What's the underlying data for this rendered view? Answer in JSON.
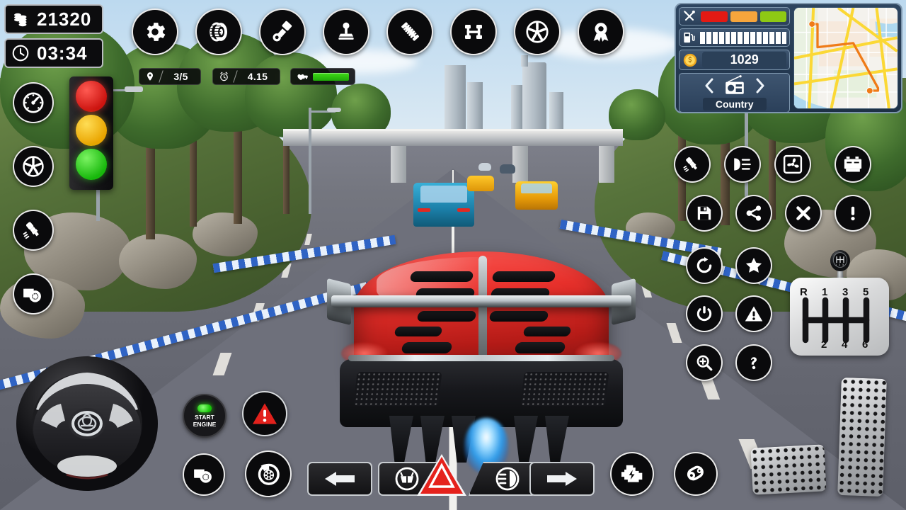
{
  "hud": {
    "coins": {
      "icon": "coins-icon",
      "value": "21320"
    },
    "timer": {
      "icon": "clock-icon",
      "value": "03:34"
    },
    "checkpoints": {
      "icon": "location-pin-icon",
      "value": "3/5"
    },
    "lap_time": {
      "icon": "alarm-clock-icon",
      "value": "4.15"
    },
    "health": {
      "icon": "car-health-icon",
      "value": "100"
    }
  },
  "top_toolbar": {
    "items": [
      {
        "name": "settings-button",
        "icon": "gear-icon",
        "label": "Settings"
      },
      {
        "name": "tire-button",
        "icon": "tire-icon",
        "label": "Tires"
      },
      {
        "name": "piston-button",
        "icon": "piston-icon",
        "label": "Piston"
      },
      {
        "name": "gearstick-button",
        "icon": "joystick-icon",
        "label": "Gear Stick"
      },
      {
        "name": "suspension-button",
        "icon": "suspension-icon",
        "label": "Suspension"
      },
      {
        "name": "chassis-button",
        "icon": "chassis-icon",
        "label": "Chassis"
      },
      {
        "name": "rim-button",
        "icon": "wheel-rim-icon",
        "label": "Rims"
      },
      {
        "name": "award-button",
        "icon": "award-medal-icon",
        "label": "Awards"
      }
    ]
  },
  "left_toolbar": {
    "items": [
      {
        "name": "speedometer-button",
        "icon": "speedometer-icon",
        "label": "Speedometer"
      },
      {
        "name": "rim-button-left",
        "icon": "wheel-rim-icon",
        "label": "Rims"
      },
      {
        "name": "spark-plug-button",
        "icon": "spark-plug-icon",
        "label": "Spark Plug"
      },
      {
        "name": "turbo-button",
        "icon": "turbocharger-icon",
        "label": "Turbo"
      }
    ]
  },
  "right_toolbar": {
    "row1": [
      {
        "name": "spark-plug-button-right",
        "icon": "spark-plug-icon",
        "label": "Spark Plug"
      },
      {
        "name": "headlight-button-right",
        "icon": "headlight-icon",
        "label": "Headlights"
      },
      {
        "name": "fan-button",
        "icon": "cooling-fan-icon",
        "label": "Cooling Fan"
      },
      {
        "name": "battery-button",
        "icon": "battery-icon",
        "label": "Battery"
      }
    ],
    "row2": [
      {
        "name": "save-button",
        "icon": "floppy-save-icon",
        "label": "Save"
      },
      {
        "name": "share-button",
        "icon": "share-icon",
        "label": "Share"
      },
      {
        "name": "close-button",
        "icon": "close-x-icon",
        "label": "Close"
      },
      {
        "name": "info-button",
        "icon": "exclamation-icon",
        "label": "Info"
      }
    ],
    "row3": [
      {
        "name": "restart-button",
        "icon": "refresh-icon",
        "label": "Restart"
      },
      {
        "name": "favorite-button",
        "icon": "star-icon",
        "label": "Favorite"
      }
    ],
    "row4": [
      {
        "name": "power-button",
        "icon": "power-icon",
        "label": "Power"
      },
      {
        "name": "warning-button",
        "icon": "warning-triangle-icon",
        "label": "Warning"
      }
    ],
    "row5": [
      {
        "name": "zoom-button",
        "icon": "magnifier-plus-icon",
        "label": "Zoom"
      },
      {
        "name": "help-button",
        "icon": "question-mark-icon",
        "label": "Help"
      }
    ]
  },
  "panel": {
    "damage": {
      "icon": "tools-icon",
      "bars": [
        {
          "name": "damage-bar-red",
          "color": "#e31a14"
        },
        {
          "name": "damage-bar-orange",
          "color": "#f6a53c"
        },
        {
          "name": "damage-bar-green",
          "color": "#8ec914"
        }
      ]
    },
    "fuel": {
      "icon": "fuel-pump-icon",
      "segments": 14,
      "filled": 14,
      "color": "#ffffff"
    },
    "cash": {
      "icon": "coin-icon",
      "value": "1029"
    },
    "radio": {
      "prev_icon": "chevron-left-icon",
      "radio_icon": "radio-icon",
      "next_icon": "chevron-right-icon",
      "station": "Country"
    },
    "minimap": {
      "name": "minimap",
      "route_color": "#ef7b18",
      "road_color": "#fbd835",
      "park_color": "#cfe7bd",
      "water_color": "#aed8ef"
    }
  },
  "bottom_controls": {
    "turn_left": {
      "name": "turn-left-button",
      "icon": "arrow-left-icon",
      "label": "Left Signal"
    },
    "wiper": {
      "name": "wiper-button",
      "icon": "windshield-wiper-icon",
      "label": "Wipers"
    },
    "hazard": {
      "name": "hazard-button",
      "icon": "hazard-triangle-icon",
      "label": "Hazard"
    },
    "headlight": {
      "name": "headlight-button",
      "icon": "headlight-icon",
      "label": "Headlights"
    },
    "turn_right": {
      "name": "turn-right-button",
      "icon": "arrow-right-icon",
      "label": "Right Signal"
    }
  },
  "bottom_left": {
    "start_engine": {
      "name": "start-engine-button",
      "line1": "START",
      "line2": "ENGINE",
      "led_color": "#2ee015"
    },
    "alert": {
      "name": "alert-button",
      "icon": "red-warning-triangle-icon",
      "label": "Alert"
    },
    "turbo": {
      "name": "turbo-button-bottom",
      "icon": "turbocharger-icon",
      "label": "Turbo"
    },
    "brake_disc": {
      "name": "brake-disc-button",
      "icon": "brake-disc-icon",
      "label": "Brakes"
    }
  },
  "bottom_right": {
    "engine_check": {
      "name": "engine-check-button",
      "icon": "engine-lightning-icon",
      "label": "Engine"
    },
    "belt": {
      "name": "timing-belt-button",
      "icon": "timing-belt-icon",
      "label": "Timing Belt"
    }
  },
  "shifter": {
    "name": "gear-shifter",
    "top_gears": [
      "R",
      "1",
      "3",
      "5"
    ],
    "bottom_gears": [
      "2",
      "4",
      "6"
    ]
  },
  "pedals": {
    "brake": {
      "name": "brake-pedal",
      "label": "Brake"
    },
    "accelerator": {
      "name": "accelerator-pedal",
      "label": "Accelerator"
    }
  },
  "steering": {
    "name": "steering-wheel",
    "label": "Steering Wheel"
  },
  "traffic_light": {
    "name": "traffic-light",
    "red": "#cc1410",
    "yellow": "#e9a400",
    "green": "#18b80c"
  },
  "scene": {
    "name": "game-world",
    "description": "Highway racing view with red supercar rear, traffic cars, overpass, city skyline"
  }
}
